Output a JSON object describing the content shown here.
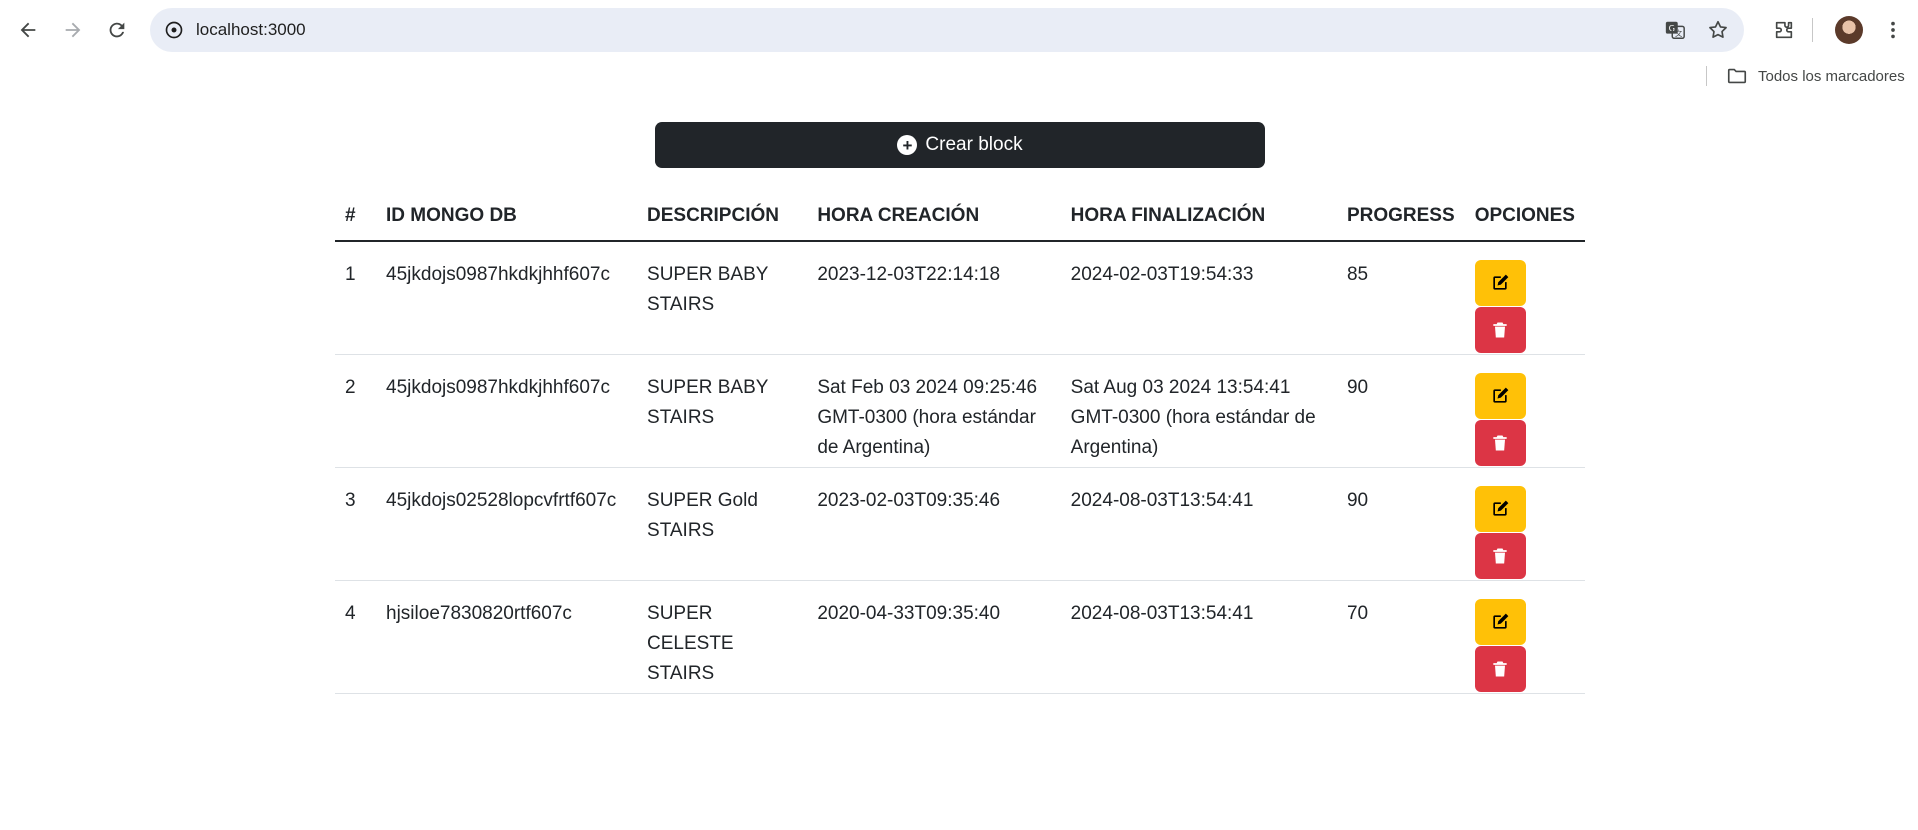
{
  "browser": {
    "url": "localhost:3000",
    "bookmarks_all_label": "Todos los marcadores"
  },
  "page": {
    "create_button_label": "Crear block",
    "table": {
      "headers": [
        "#",
        "ID MONGO DB",
        "DESCRIPCIÓN",
        "HORA CREACIÓN",
        "HORA FINALIZACIÓN",
        "PROGRESS",
        "OPCIONES"
      ],
      "rows": [
        {
          "num": "1",
          "id": "45jkdojs0987hkdkjhhf607c",
          "description": "SUPER BABY STAIRS",
          "created": "2023-12-03T22:14:18",
          "finished": "2024-02-03T19:54:33",
          "progress": "85"
        },
        {
          "num": "2",
          "id": "45jkdojs0987hkdkjhhf607c",
          "description": "SUPER BABY STAIRS",
          "created": "Sat Feb 03 2024 09:25:46 GMT-0300 (hora estándar de Argentina)",
          "finished": "Sat Aug 03 2024 13:54:41 GMT-0300 (hora estándar de Argentina)",
          "progress": "90"
        },
        {
          "num": "3",
          "id": "45jkdojs02528lopcvfrtf607c",
          "description": "SUPER Gold STAIRS",
          "created": "2023-02-03T09:35:46",
          "finished": "2024-08-03T13:54:41",
          "progress": "90"
        },
        {
          "num": "4",
          "id": "hjsiloe7830820rtf607c",
          "description": "SUPER CELESTE STAIRS",
          "created": "2020-04-33T09:35:40",
          "finished": "2024-08-03T13:54:41",
          "progress": "70"
        }
      ]
    }
  },
  "colors": {
    "dark_button": "#212529",
    "edit_button": "#ffc107",
    "delete_button": "#dc3545"
  },
  "icons": {
    "back": "arrow-left-icon",
    "forward": "arrow-right-icon",
    "reload": "reload-icon",
    "site_info": "site-info-icon",
    "translate": "translate-icon",
    "bookmark": "star-icon",
    "extensions": "puzzle-icon",
    "menu": "kebab-menu-icon",
    "folder": "folder-icon",
    "create": "plus-circle-icon",
    "edit": "edit-icon",
    "delete": "trash-icon"
  }
}
